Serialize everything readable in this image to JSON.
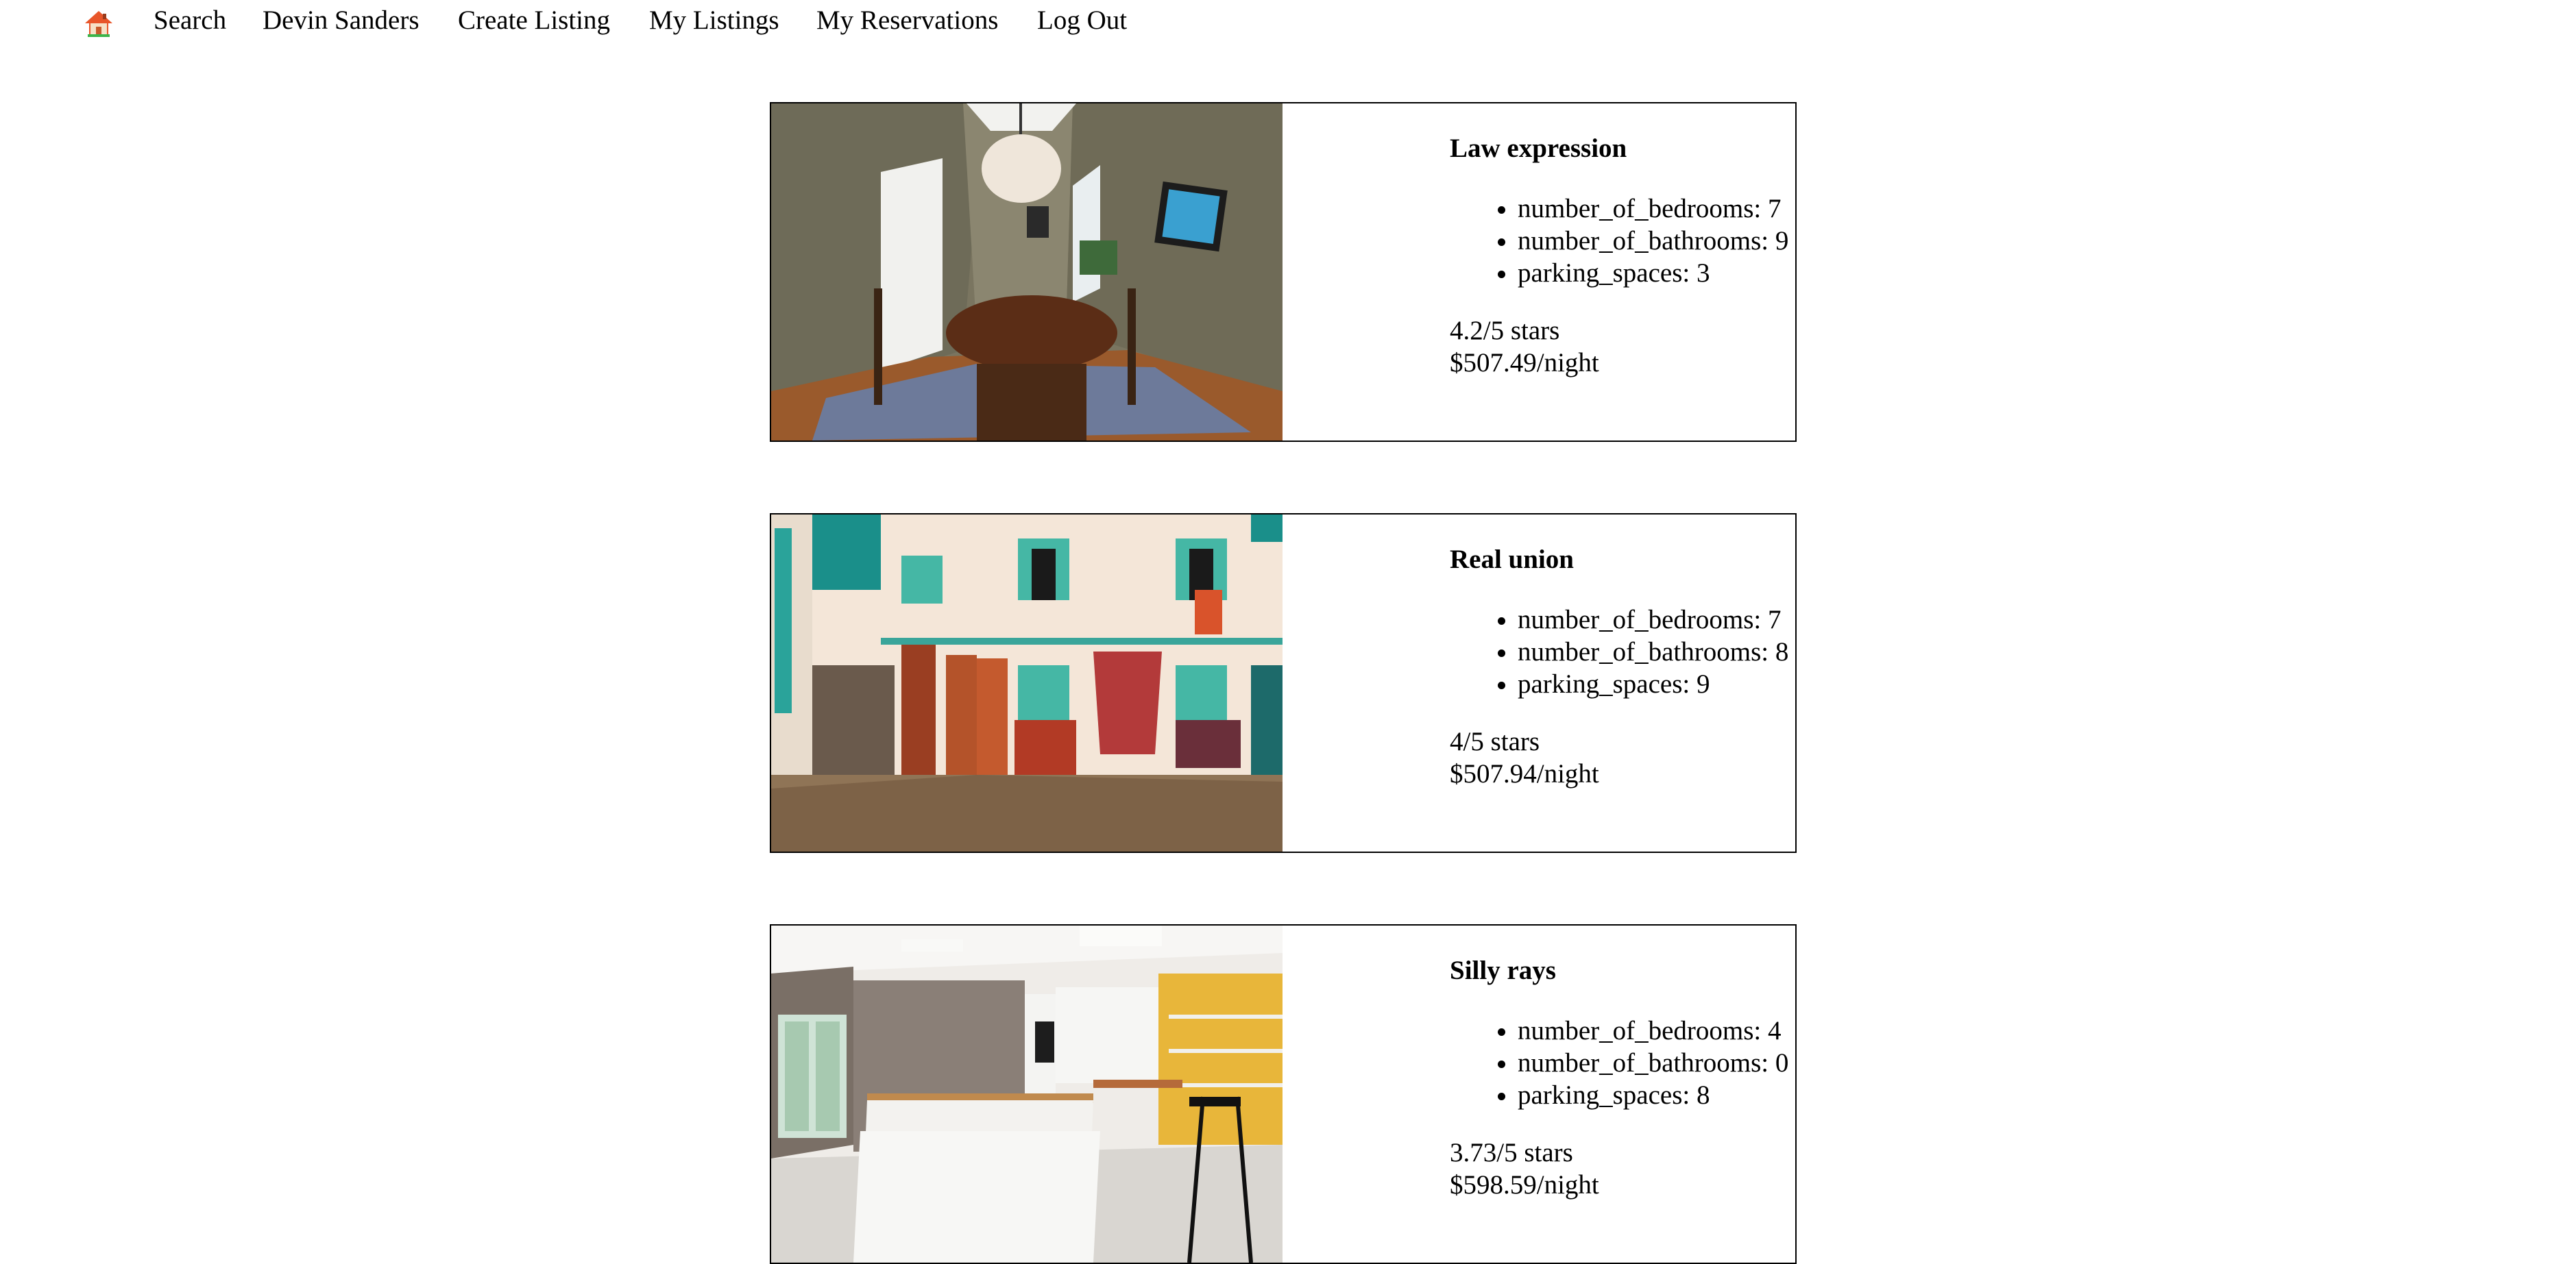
{
  "nav": {
    "home_icon": "house-icon",
    "items": [
      {
        "label": "Search"
      },
      {
        "label": "Devin Sanders"
      },
      {
        "label": "Create Listing"
      },
      {
        "label": "My Listings"
      },
      {
        "label": "My Reservations"
      },
      {
        "label": "Log Out"
      }
    ]
  },
  "listings": [
    {
      "title": "Law expression",
      "image": "dining-room-photo",
      "features": [
        "number_of_bedrooms: 7",
        "number_of_bathrooms: 9",
        "parking_spaces: 3"
      ],
      "rating": "4.2/5 stars",
      "price": "$507.49/night"
    },
    {
      "title": "Real union",
      "image": "courtyard-rugs-photo",
      "features": [
        "number_of_bedrooms: 7",
        "number_of_bathrooms: 8",
        "parking_spaces: 9"
      ],
      "rating": "4/5 stars",
      "price": "$507.94/night"
    },
    {
      "title": "Silly rays",
      "image": "kitchen-photo",
      "features": [
        "number_of_bedrooms: 4",
        "number_of_bathrooms: 0",
        "parking_spaces: 8"
      ],
      "rating": "3.73/5 stars",
      "price": "$598.59/night"
    }
  ]
}
